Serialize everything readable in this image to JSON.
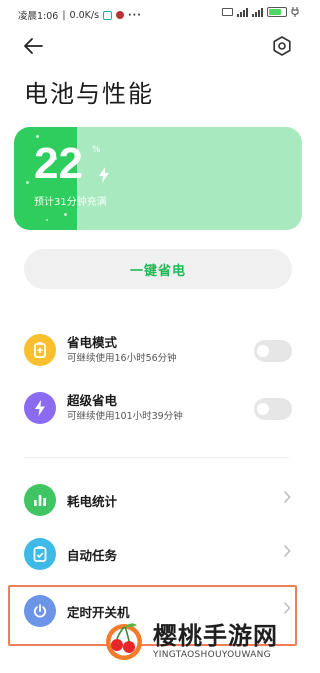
{
  "status_bar": {
    "time": "凌晨1:06",
    "speed": "0.0K/s",
    "dots": "···",
    "battery_level": 0.8
  },
  "page": {
    "title": "电池与性能"
  },
  "battery": {
    "percent": "22",
    "percent_sign": "%",
    "estimate": "预计31分钟充满",
    "level": 0.22
  },
  "one_tap_save": {
    "label": "一键省电"
  },
  "modes": [
    {
      "title": "省电模式",
      "subtitle": "可继续使用16小时56分钟",
      "icon": "battery-saver-icon",
      "icon_color": "#f8c02f",
      "enabled": false
    },
    {
      "title": "超级省电",
      "subtitle": "可继续使用101小时39分钟",
      "icon": "lightning-icon",
      "icon_color": "#8b6cf0",
      "enabled": false
    }
  ],
  "menu": [
    {
      "title": "耗电统计",
      "icon": "bar-chart-icon",
      "icon_color": "#41c463"
    },
    {
      "title": "自动任务",
      "icon": "clipboard-icon",
      "icon_color": "#3fb9e8"
    },
    {
      "title": "定时开关机",
      "icon": "power-icon",
      "icon_color": "#6c95e8"
    }
  ],
  "watermark": {
    "title": "樱桃手游网",
    "subtitle": "YINGTAOSHOUYOUWANG"
  },
  "colors": {
    "accent_green": "#1db954",
    "battery_fill": "#2fcc5e",
    "battery_bg": "#a9e9bf",
    "highlight": "#ef7e5a"
  }
}
